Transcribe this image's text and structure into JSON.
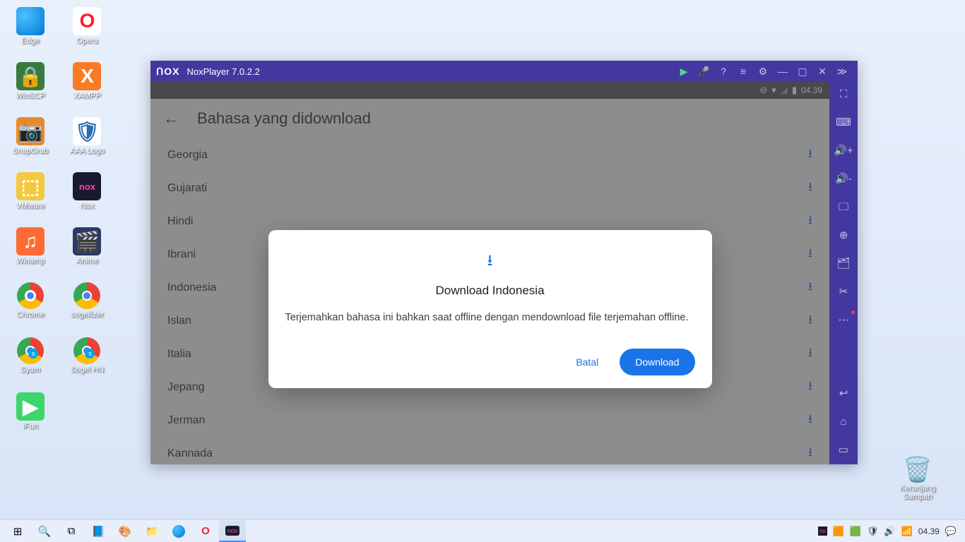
{
  "desktop": {
    "col1": [
      {
        "label": "Edge"
      },
      {
        "label": "WinSCP"
      },
      {
        "label": "SnapGrab"
      },
      {
        "label": "VMware"
      },
      {
        "label": "Winamp"
      },
      {
        "label": "Chrome"
      },
      {
        "label": "Syam"
      },
      {
        "label": "iFun"
      }
    ],
    "col2": [
      {
        "label": "Opera"
      },
      {
        "label": "XAMPP"
      },
      {
        "label": "AAA Logo"
      },
      {
        "label": "Nox"
      },
      {
        "label": "Anime"
      },
      {
        "label": "sogellizer"
      },
      {
        "label": "Sogel HN"
      }
    ],
    "recycle": "Keranjang Sampah"
  },
  "nox": {
    "logo": "ᑎOX",
    "title": "NoxPlayer 7.0.2.2"
  },
  "android": {
    "time": "04.39",
    "app_title": "Bahasa yang didownload",
    "languages": [
      "Georgia",
      "Gujarati",
      "Hindi",
      "Ibrani",
      "Indonesia",
      "Islan",
      "Italia",
      "Jepang",
      "Jerman",
      "Kannada"
    ]
  },
  "dialog": {
    "title": "Download Indonesia",
    "message": "Terjemahkan bahasa ini bahkan saat offline dengan mendownload file terjemahan offline.",
    "cancel": "Batal",
    "confirm": "Download"
  },
  "taskbar": {
    "clock": "04.39"
  }
}
